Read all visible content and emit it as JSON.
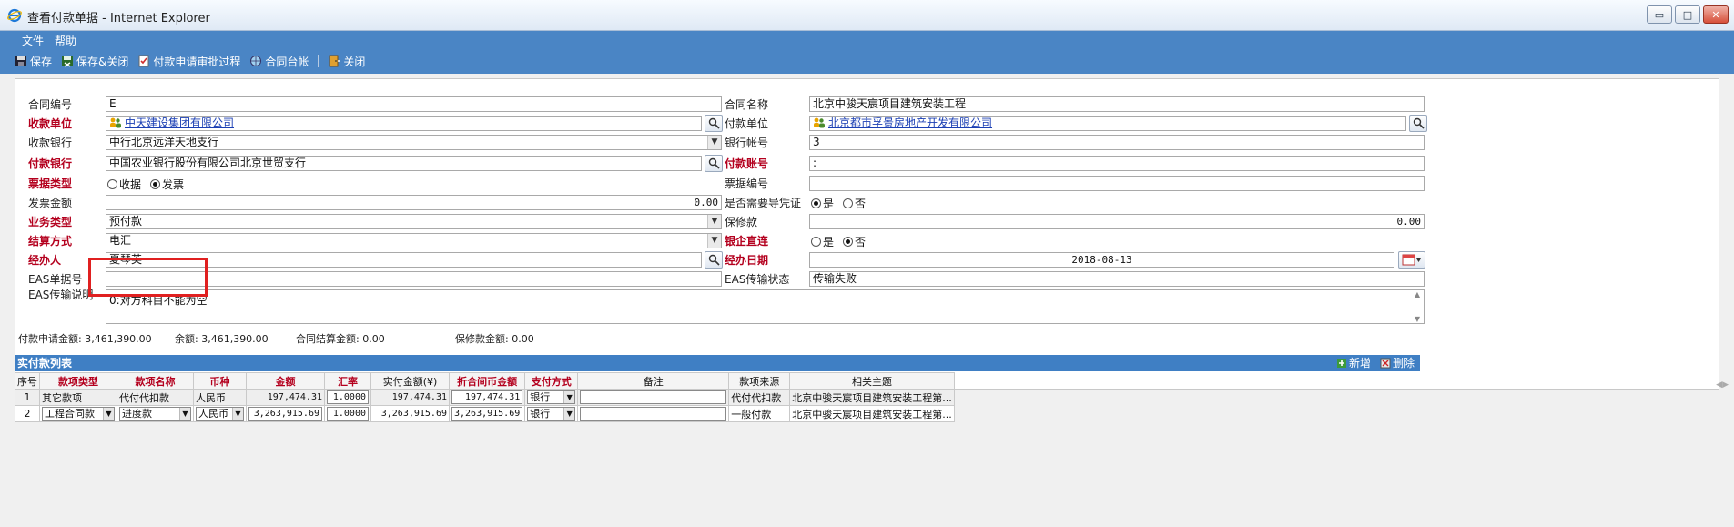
{
  "window": {
    "title": "查看付款单据 - Internet Explorer",
    "buttons": {
      "minimize": "▭",
      "maximize": "□",
      "close": "✕"
    }
  },
  "menu": [
    "文件",
    "帮助"
  ],
  "toolbar": {
    "save": "保存",
    "save_close": "保存&关闭",
    "approval": "付款申请审批过程",
    "ledger": "合同台帐",
    "close": "关闭"
  },
  "form": {
    "contract_no": {
      "label": "合同编号",
      "value": "E"
    },
    "contract_name": {
      "label": "合同名称",
      "value": "北京中骏天宸项目建筑安装工程"
    },
    "payee": {
      "label": "收款单位",
      "value": "中天建设集团有限公司"
    },
    "payer": {
      "label": "付款单位",
      "value": "北京都市孚景房地产开发有限公司"
    },
    "payee_bank": {
      "label": "收款银行",
      "value": "中行北京远洋天地支行"
    },
    "bank_account": {
      "label": "银行帐号",
      "value": "3"
    },
    "payer_bank": {
      "label": "付款银行",
      "value": "中国农业银行股份有限公司北京世贸支行"
    },
    "payer_account": {
      "label": "付款账号",
      "value": ":"
    },
    "bill_type": {
      "label": "票据类型",
      "options": [
        "收据",
        "发票"
      ],
      "selected": "发票"
    },
    "bill_no": {
      "label": "票据编号",
      "value": ""
    },
    "invoice_amount": {
      "label": "发票金额",
      "value": "0.00"
    },
    "need_voucher": {
      "label": "是否需要导凭证",
      "options": [
        "是",
        "否"
      ],
      "selected": "是"
    },
    "business_type": {
      "label": "业务类型",
      "value": "预付款"
    },
    "retention": {
      "label": "保修款",
      "value": "0.00"
    },
    "settlement": {
      "label": "结算方式",
      "value": "电汇"
    },
    "bank_direct": {
      "label": "银企直连",
      "options": [
        "是",
        "否"
      ],
      "selected": "否"
    },
    "handler": {
      "label": "经办人",
      "value": "夏琴英"
    },
    "handle_date": {
      "label": "经办日期",
      "value": "2018-08-13"
    },
    "eas_no": {
      "label": "EAS单据号",
      "value": ""
    },
    "eas_status": {
      "label": "EAS传输状态",
      "value": "传输失败"
    },
    "eas_desc": {
      "label": "EAS传输说明",
      "value": "0:对方科目不能为空"
    }
  },
  "summary": {
    "apply_amount": "付款申请金额: 3,461,390.00",
    "balance": "余额: 3,461,390.00",
    "settle_amount": "合同结算金额: 0.00",
    "retention_amount": "保修款金额: 0.00"
  },
  "grid": {
    "title": "实付款列表",
    "add": "新增",
    "delete": "删除",
    "columns": [
      "序号",
      "款项类型",
      "款项名称",
      "币种",
      "金额",
      "汇率",
      "实付金额(¥)",
      "折合间币金额",
      "支付方式",
      "备注",
      "款项来源",
      "相关主题"
    ],
    "rows": [
      {
        "no": "1",
        "type": "其它款项",
        "name": "代付代扣款",
        "currency": "人民币",
        "amount": "197,474.31",
        "rate": "1.0000",
        "paid": "197,474.31",
        "converted": "197,474.31",
        "method": "银行",
        "remark": "",
        "source": "代付代扣款",
        "subject": "北京中骏天宸项目建筑安装工程第..."
      },
      {
        "no": "2",
        "type": "工程合同款",
        "name": "进度款",
        "currency": "人民币",
        "amount": "3,263,915.69",
        "rate": "1.0000",
        "paid": "3,263,915.69",
        "converted": "3,263,915.69",
        "method": "银行",
        "remark": "",
        "source": "一般付款",
        "subject": "北京中骏天宸项目建筑安装工程第..."
      }
    ]
  },
  "colors": {
    "accent": "#4a85c5",
    "required_label": "#b4001e",
    "highlight": "#e02020"
  }
}
